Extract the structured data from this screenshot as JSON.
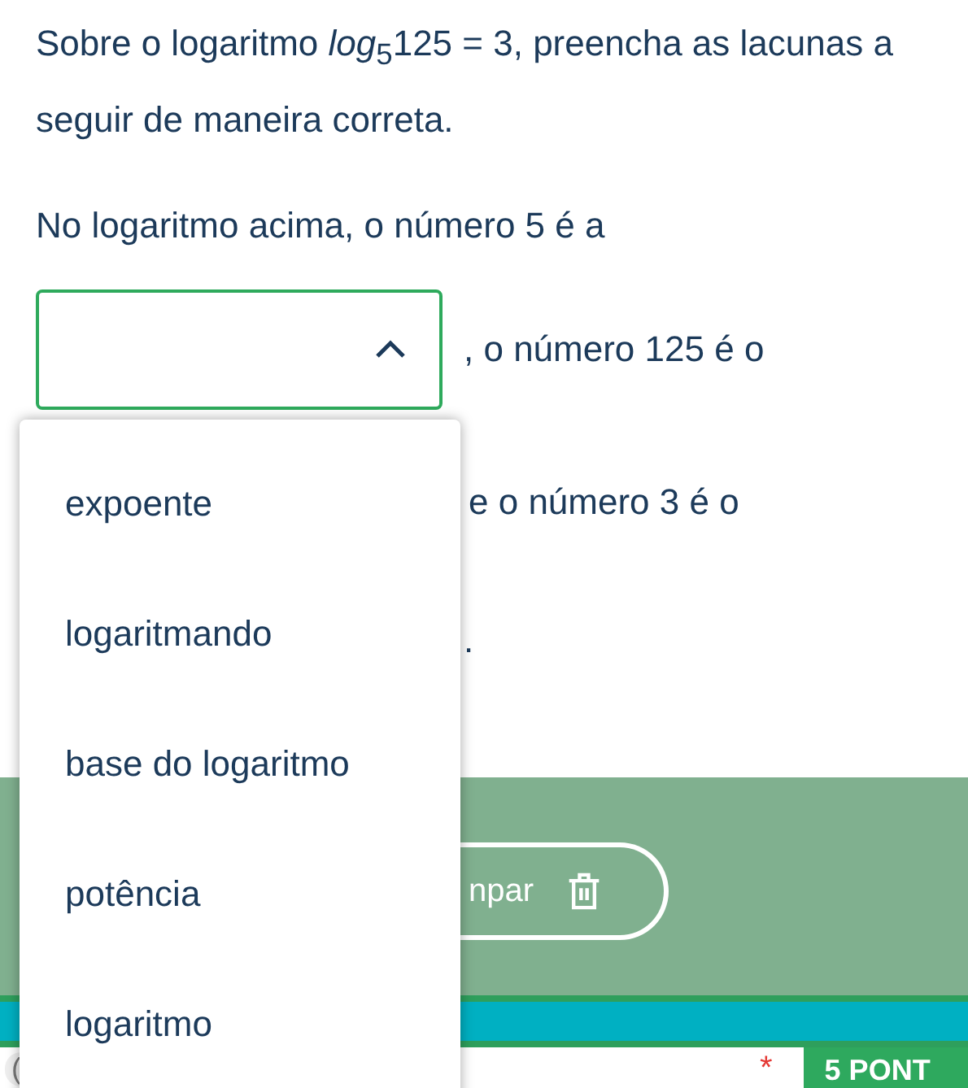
{
  "question": {
    "intro": "Sobre o logaritmo *log*$_{5}$125 = 3, preencha as lacunas a seguir de maneira correta.",
    "prompt": "No logaritmo acima, o número 5 é a"
  },
  "select": {
    "expanded": true,
    "options": [
      {
        "label": "expoente",
        "selected": false
      },
      {
        "label": "logaritmando",
        "selected": false
      },
      {
        "label": "base do logaritmo",
        "selected": false
      },
      {
        "label": "potência",
        "selected": false
      },
      {
        "label": "logaritmo",
        "selected": false
      }
    ]
  },
  "after_select": ", o número 125 é o",
  "second_line": "e o número 3 é o",
  "end_mark": ".",
  "clear_button": {
    "label": "npar"
  },
  "footer": {
    "paren": "(",
    "required_mark": "*",
    "points": "5 PONT"
  }
}
